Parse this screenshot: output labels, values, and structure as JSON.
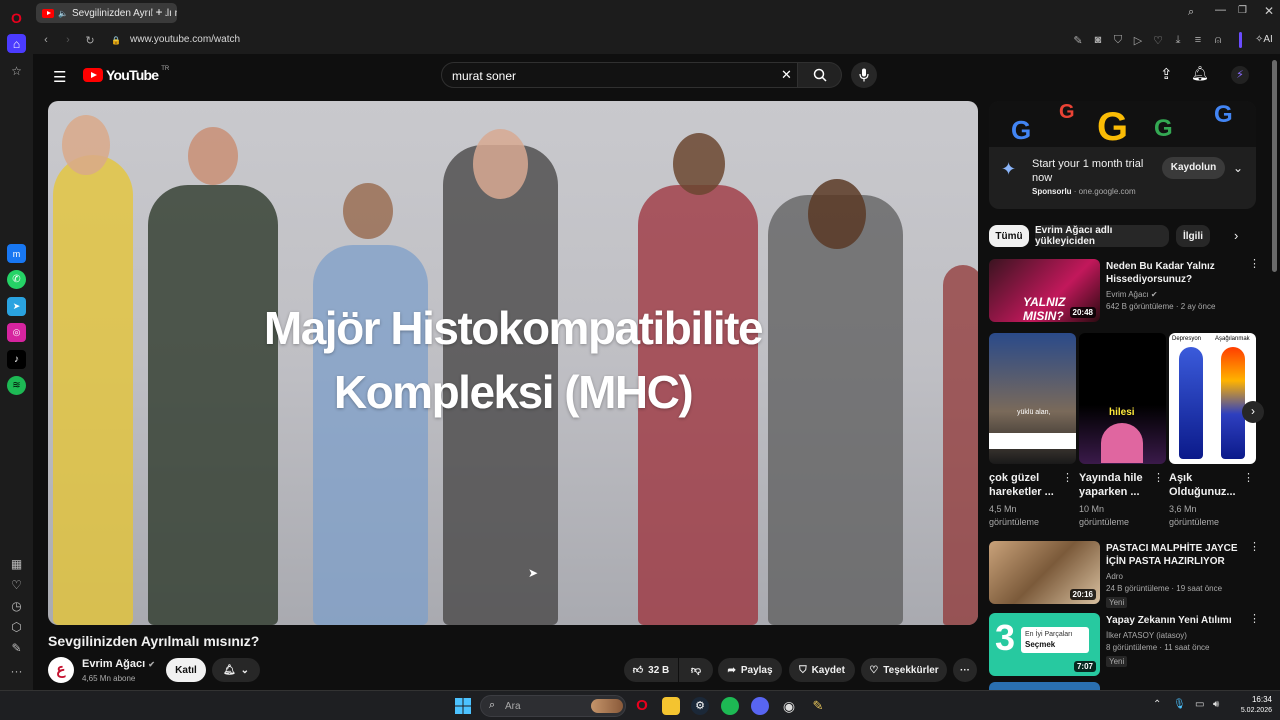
{
  "browser": {
    "tab_title": "Sevgilinizden Ayrılmalı mısınız?",
    "url": "www.youtube.com/watch",
    "ai_label": "AI"
  },
  "youtube": {
    "logo_text": "YouTube",
    "logo_region": "TR",
    "search_value": "murat soner"
  },
  "video": {
    "overlay_line1": "Majör Histokompatibilite",
    "overlay_line2": "Kompleksi (MHC)",
    "title": "Sevgilinizden Ayrılmalı mısınız?",
    "channel": "Evrim Ağacı",
    "subscribers": "4,65 Mn abone",
    "join_label": "Katıl",
    "likes": "32 B",
    "share_label": "Paylaş",
    "save_label": "Kaydet",
    "thanks_label": "Teşekkürler"
  },
  "ad": {
    "title_line1": "Start your 1 month trial",
    "title_line2": "now",
    "sponsored": "Sponsorlu",
    "domain": "· one.google.com",
    "cta": "Kaydolun"
  },
  "chips": [
    "Tümü",
    "Evrim Ağacı adlı yükleyiciden",
    "İlgili"
  ],
  "recommendations": [
    {
      "title_line1": "Neden Bu Kadar Yalnız",
      "title_line2": "Hissediyorsunuz?",
      "channel": "Evrim Ağacı",
      "meta": "642 B görüntüleme · 2 ay önce",
      "duration": "20:48",
      "thumb_text": "YALNIZ MISIN?"
    },
    {
      "title_line1": "PASTACI MALPHİTE JAYCE",
      "title_line2": "İÇİN PASTA HAZIRLIYOR",
      "channel": "Adro",
      "meta": "24 B görüntüleme · 19 saat önce",
      "duration": "20:16",
      "badge": "Yeni"
    },
    {
      "title_line1": "Yapay Zekanın Yeni Atılımı",
      "title_line2": "",
      "channel": "İlker ATASOY (iatasoy)",
      "meta": "8 görüntüleme · 11 saat önce",
      "duration": "7:07",
      "badge": "Yeni",
      "thumb_text_1": "En İyi Parçaları",
      "thumb_text_2": "Seçmek"
    }
  ],
  "shorts": [
    {
      "title_line1": "çok güzel",
      "title_line2": "hareketler ...",
      "views_line1": "4,5 Mn",
      "views_line2": "görüntüleme",
      "thumb_text": "yüklü alan,"
    },
    {
      "title_line1": "Yayında hile",
      "title_line2": "yaparken ...",
      "views_line1": "10 Mn",
      "views_line2": "görüntüleme",
      "thumb_text": "hilesi"
    },
    {
      "title_line1": "Aşık",
      "title_line2": "Olduğunuz...",
      "views_line1": "3,6 Mn",
      "views_line2": "görüntüleme",
      "thumb_label_left": "Depresyon",
      "thumb_label_right": "Aşağılanmak"
    }
  ],
  "taskbar": {
    "search_placeholder": "Ara",
    "time": "16:34",
    "date": "5.02.2026"
  },
  "colors": {
    "youtube_red": "#ff0000",
    "background": "#0f0f0f",
    "chip_bg": "#272727",
    "opera_red": "#e8001d"
  }
}
